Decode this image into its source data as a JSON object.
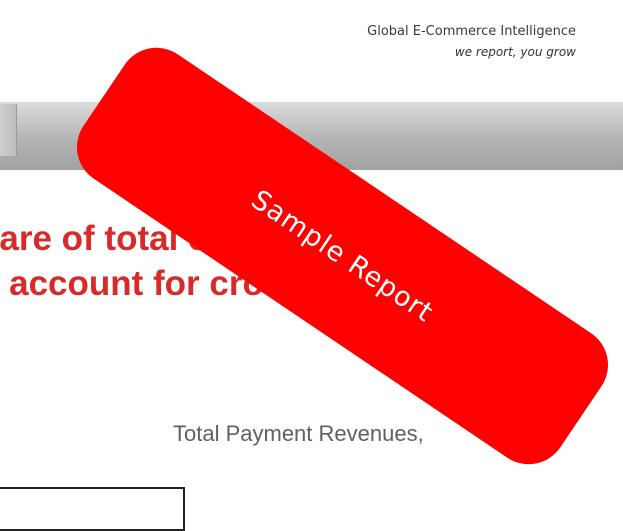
{
  "header": {
    "brand_name": "Global E-Commerce Intelligence",
    "tagline": "we report, you grow"
  },
  "headline": {
    "line1": "hare of total commercial",
    "line2": "o account for cross-"
  },
  "subheading": "Total Payment Revenues,",
  "stamp": {
    "text": "Sample Report",
    "color": "#ff0000"
  },
  "colors": {
    "headline": "#d82a28",
    "banner": "#b4b4b4"
  }
}
